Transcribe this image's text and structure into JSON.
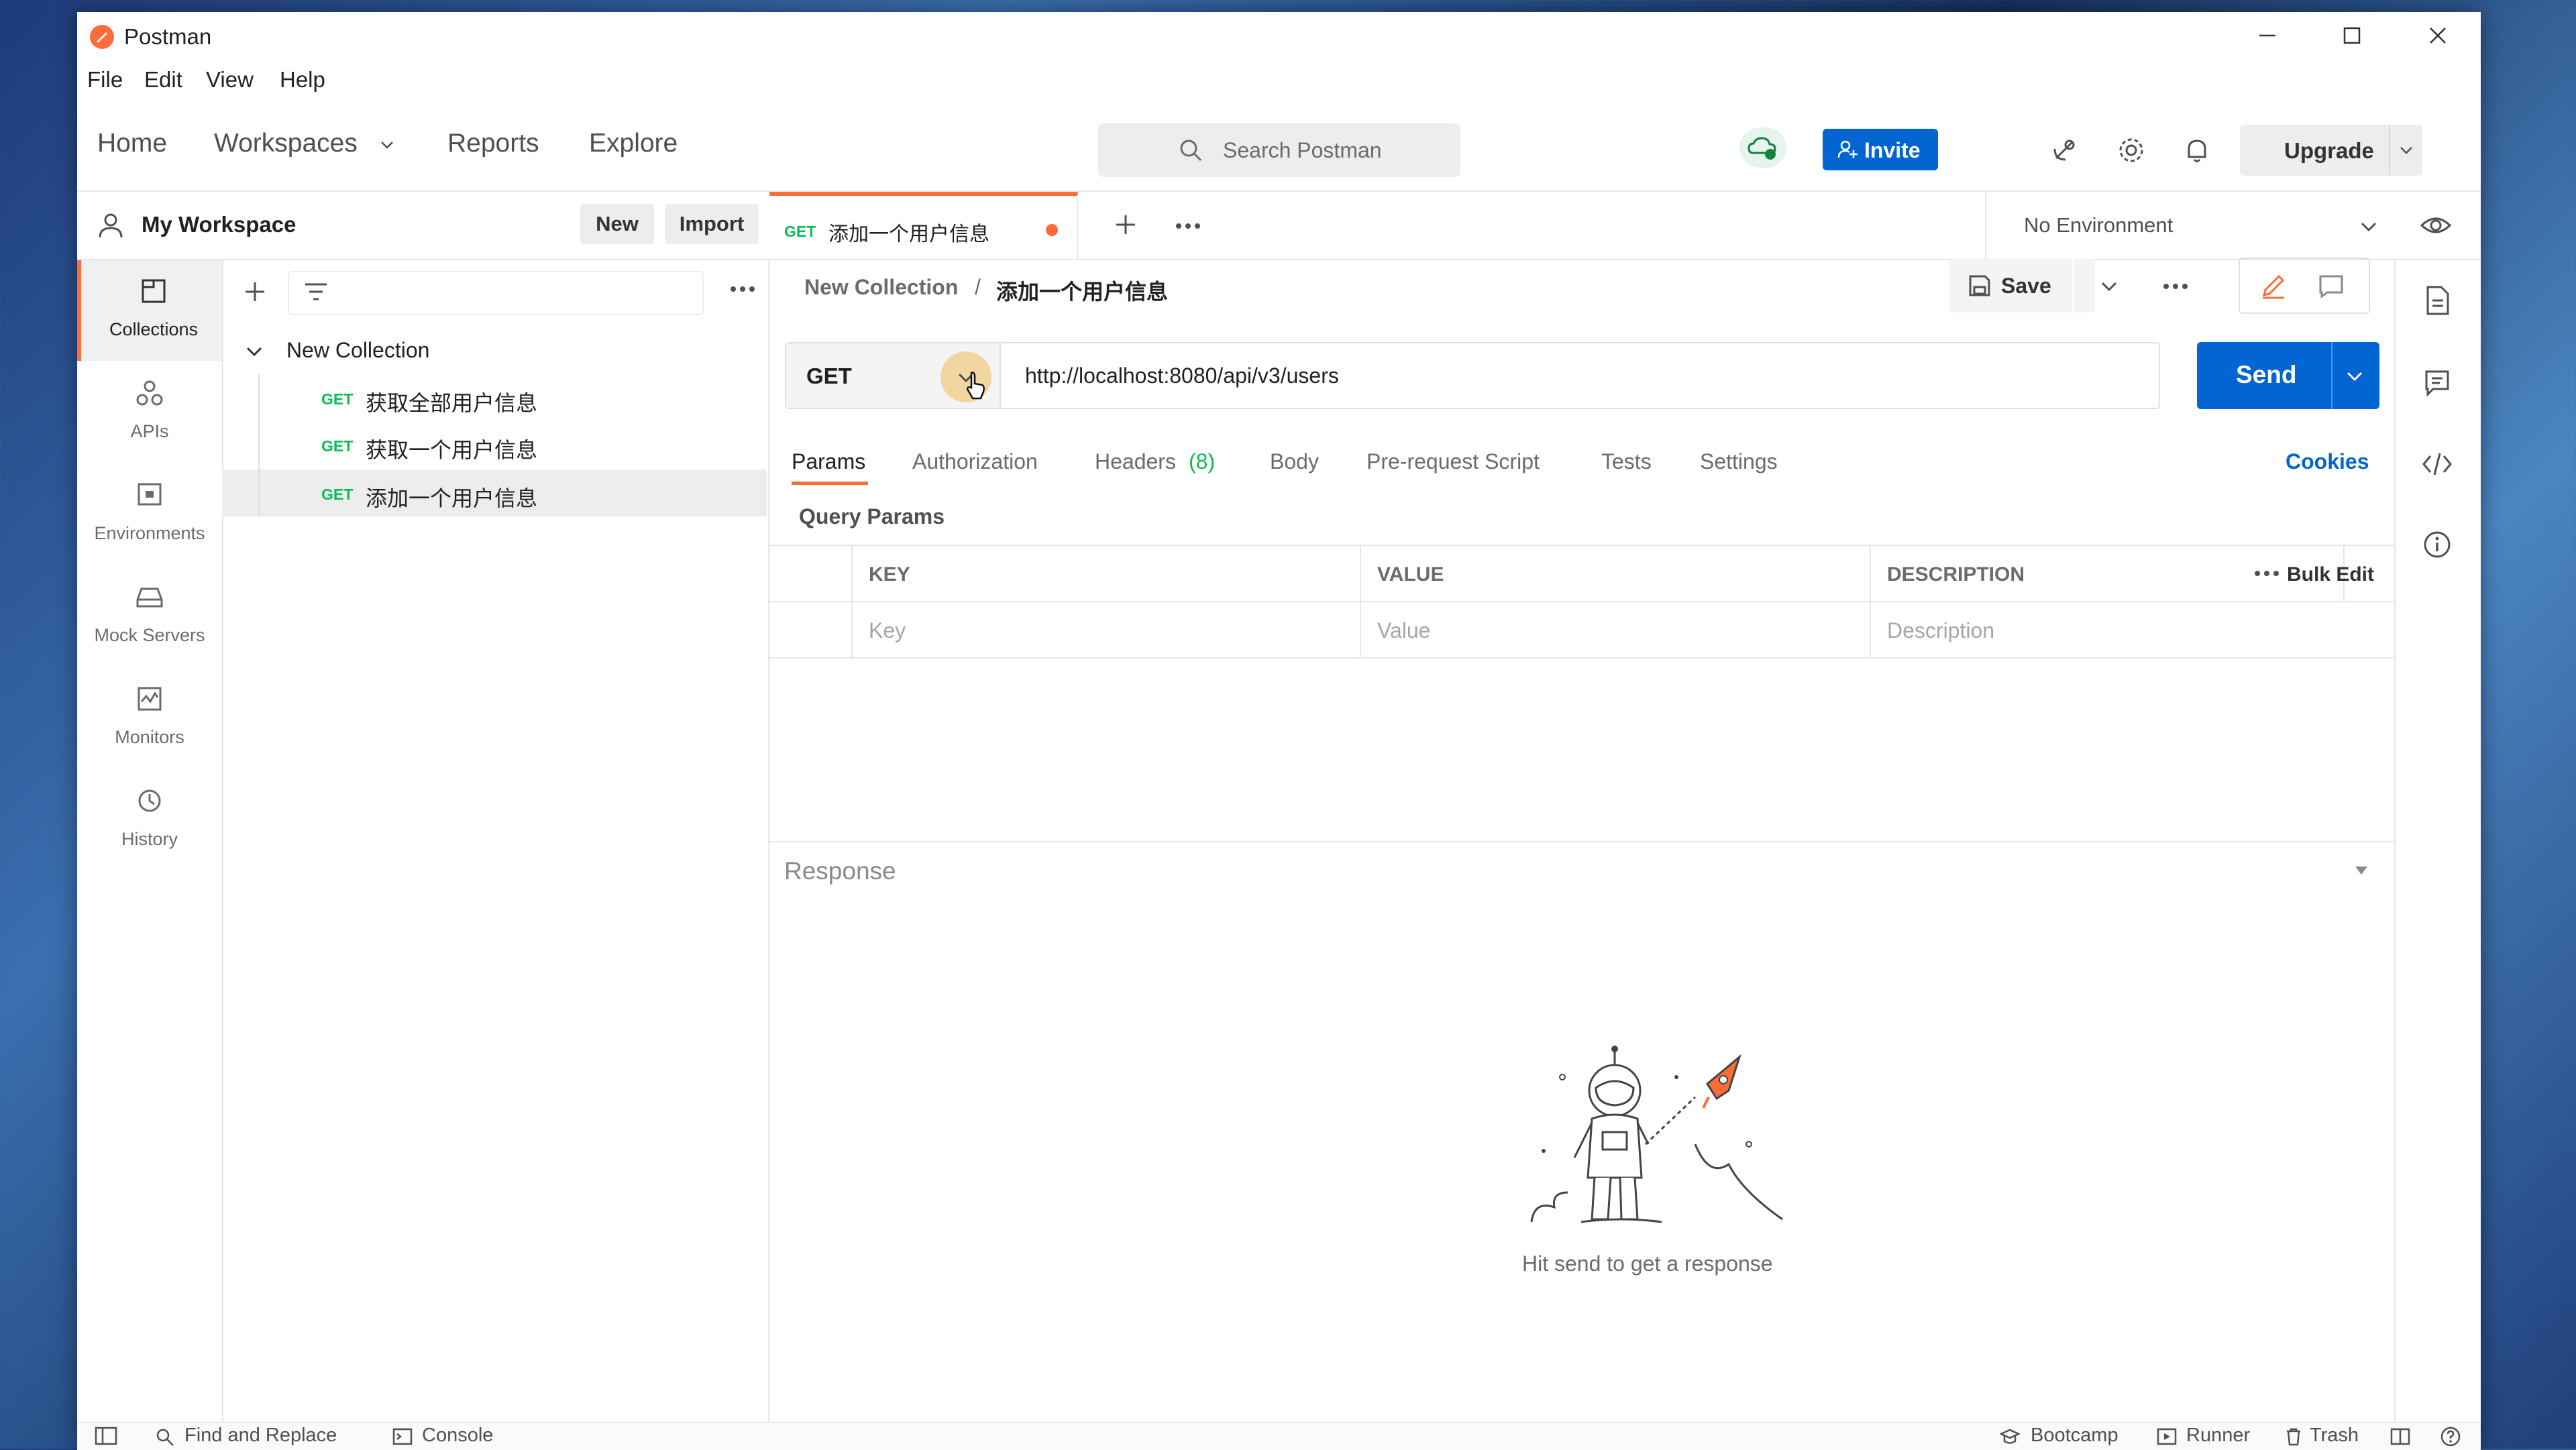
{
  "app": {
    "title": "Postman",
    "logo_color": "#ff6c37"
  },
  "menu": [
    "File",
    "Edit",
    "View",
    "Help"
  ],
  "header": {
    "nav": {
      "home": "Home",
      "workspaces": "Workspaces",
      "reports": "Reports",
      "explore": "Explore"
    },
    "search_placeholder": "Search Postman",
    "invite": "Invite",
    "upgrade": "Upgrade"
  },
  "workspace": {
    "name": "My Workspace",
    "new_label": "New",
    "import_label": "Import"
  },
  "sidebar": {
    "items": [
      {
        "label": "Collections",
        "icon": "collections-icon"
      },
      {
        "label": "APIs",
        "icon": "apis-icon"
      },
      {
        "label": "Environments",
        "icon": "environments-icon"
      },
      {
        "label": "Mock Servers",
        "icon": "mock-servers-icon"
      },
      {
        "label": "Monitors",
        "icon": "monitors-icon"
      },
      {
        "label": "History",
        "icon": "history-icon"
      }
    ]
  },
  "collection": {
    "name": "New Collection",
    "requests": [
      {
        "method": "GET",
        "name": "获取全部用户信息"
      },
      {
        "method": "GET",
        "name": "获取一个用户信息"
      },
      {
        "method": "GET",
        "name": "添加一个用户信息"
      }
    ]
  },
  "tab": {
    "method": "GET",
    "name": "添加一个用户信息"
  },
  "environment": "No Environment",
  "breadcrumb": {
    "collection": "New Collection",
    "separator": "/",
    "request": "添加一个用户信息"
  },
  "save_label": "Save",
  "request": {
    "method": "GET",
    "url": "http://localhost:8080/api/v3/users",
    "send_label": "Send"
  },
  "request_tabs": {
    "params": "Params",
    "authorization": "Authorization",
    "headers": "Headers",
    "headers_count": "(8)",
    "body": "Body",
    "prerequest": "Pre-request Script",
    "tests": "Tests",
    "settings": "Settings",
    "cookies": "Cookies"
  },
  "query_params": {
    "title": "Query Params",
    "headers": {
      "key": "KEY",
      "value": "VALUE",
      "description": "DESCRIPTION"
    },
    "bulk_edit": "Bulk Edit",
    "placeholders": {
      "key": "Key",
      "value": "Value",
      "description": "Description"
    }
  },
  "response": {
    "title": "Response",
    "empty_text": "Hit send to get a response"
  },
  "statusbar": {
    "find_replace": "Find and Replace",
    "console": "Console",
    "bootcamp": "Bootcamp",
    "runner": "Runner",
    "trash": "Trash"
  },
  "colors": {
    "accent": "#ff6c37",
    "primary": "#0265d2",
    "get": "#0cbb52"
  }
}
